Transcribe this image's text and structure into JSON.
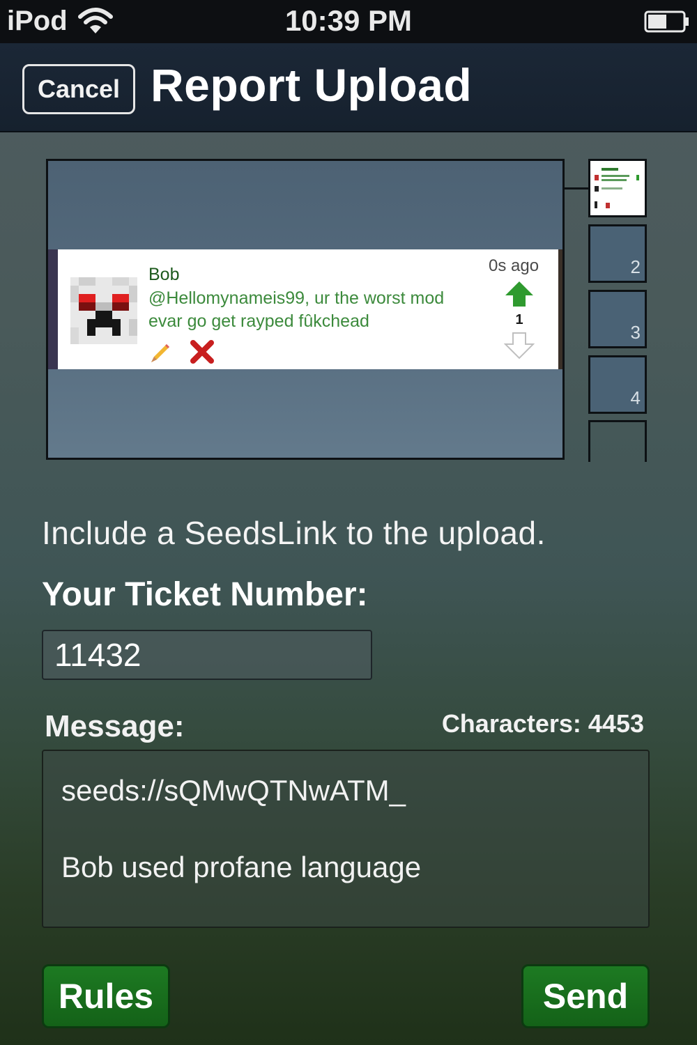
{
  "status_bar": {
    "device": "iPod",
    "time": "10:39 PM"
  },
  "nav": {
    "cancel_label": "Cancel",
    "title": "Report Upload"
  },
  "preview": {
    "post": {
      "author": "Bob",
      "text": "@Hellomynameis99, ur the worst mod evar go get rayped fûkchead",
      "time": "0s ago",
      "votes": "1"
    },
    "thumbnails": [
      "2",
      "3",
      "4"
    ]
  },
  "form": {
    "instruction": "Include a SeedsLink to the upload.",
    "ticket_label": "Your Ticket Number:",
    "ticket_value": "11432",
    "message_label": "Message:",
    "char_count": "Characters: 4453",
    "message_line_1": "seeds://sQMwQTNwATM_",
    "message_line_2": "Bob used profane language"
  },
  "buttons": {
    "rules_label": "Rules",
    "send_label": "Send"
  },
  "colors": {
    "accent_green": "#146218",
    "nav_bg": "#16212e"
  }
}
